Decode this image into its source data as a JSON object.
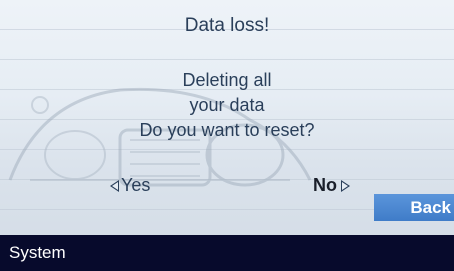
{
  "dialog": {
    "title": "Data loss!",
    "message_lines": [
      "Deleting all",
      "your data",
      "Do you want to reset?"
    ]
  },
  "buttons": {
    "yes_label": "Yes",
    "no_label": "No",
    "back_label": "Back"
  },
  "status_bar": {
    "label": "System"
  },
  "colors": {
    "text": "#2a3f5a",
    "accent": "#4a87d2",
    "status_bar_bg": "#070a2c"
  },
  "icons": {
    "yes_arrow": "triangle-left-icon",
    "no_arrow": "triangle-right-icon"
  }
}
